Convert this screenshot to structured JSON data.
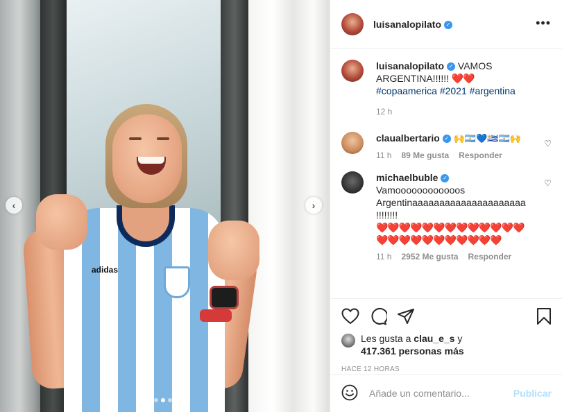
{
  "header": {
    "username": "luisanalopilato",
    "more_label": "•••"
  },
  "photo": {
    "brand_text": "adidas",
    "nav_prev_glyph": "‹",
    "nav_next_glyph": "›",
    "carousel_pages": 3,
    "carousel_active_index": 1
  },
  "caption": {
    "username": "luisanalopilato",
    "text": "VAMOS ARGENTINA!!!!!! ",
    "emoji": "❤️❤️",
    "hashtags": [
      "#copaamerica",
      "#2021",
      "#argentina"
    ],
    "time": "12 h"
  },
  "comments": [
    {
      "username": "claualbertario",
      "text": "🙌🇦🇷💙🇺🇾🇦🇷🙌",
      "time": "11 h",
      "likes": "89 Me gusta",
      "reply": "Responder"
    },
    {
      "username": "michaelbuble",
      "text": "Vamoooooooooooos Argentinaaaaaaaaaaaaaaaaaaaaa !!!!!!!!",
      "hearts": "❤️❤️❤️❤️❤️❤️❤️❤️❤️❤️❤️❤️❤️❤️❤️❤️❤️❤️❤️❤️❤️❤️❤️❤️",
      "time": "11 h",
      "likes": "2952 Me gusta",
      "reply": "Responder"
    }
  ],
  "likes": {
    "prefix": "Les gusta a ",
    "user": "clau_e_s",
    "joiner": " y",
    "others": "417.361 personas más"
  },
  "timestamp": "HACE 12 HORAS",
  "add_comment": {
    "placeholder": "Añade un comentario...",
    "publish": "Publicar"
  },
  "icons": {
    "like": "heart-icon",
    "comment": "comment-icon",
    "share": "share-icon",
    "save": "bookmark-icon",
    "emoji": "emoji-icon",
    "verified": "verified-badge-icon"
  },
  "colors": {
    "verified": "#3897f0",
    "hashtag": "#00376b",
    "secondary_text": "#8e8e8e",
    "publish_disabled": "#b2dffc"
  }
}
